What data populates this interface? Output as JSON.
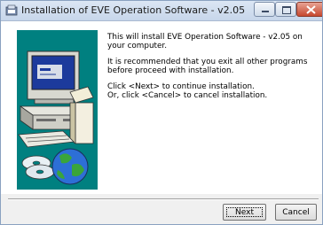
{
  "window": {
    "title": "Installation of EVE Operation Software - v2.05"
  },
  "content": {
    "paragraphs": [
      "This will install EVE Operation Software - v2.05 on your computer.",
      "It is recommended that you exit all other programs before proceed with installation.",
      "Click <Next> to continue installation.\nOr, click <Cancel> to cancel installation."
    ]
  },
  "buttons": {
    "next": "Next",
    "cancel": "Cancel"
  },
  "colors": {
    "art_background": "#008080"
  },
  "icons": [
    "installer-app-icon",
    "minimize-icon",
    "maximize-icon",
    "close-icon",
    "computer-illustration",
    "cd-disc-icon",
    "globe-icon"
  ]
}
